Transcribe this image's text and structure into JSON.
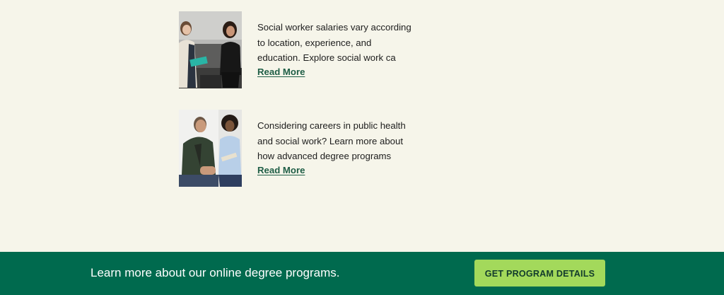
{
  "articles": [
    {
      "excerpt": "Social worker salaries vary according to location, experience, and education. Explore social work ca",
      "read_more_label": "Read More",
      "image_icon": "photo-two-women-sofa"
    },
    {
      "excerpt": "Considering careers in public health and social work? Learn more about how advanced degree programs",
      "read_more_label": "Read More",
      "image_icon": "photo-man-woman-counseling"
    }
  ],
  "cta": {
    "text": "Learn more about our online degree programs.",
    "button_label": "GET PROGRAM DETAILS"
  },
  "colors": {
    "page_background": "#f6f5ea",
    "link": "#1f5e46",
    "cta_bar": "#006a4e",
    "cta_button": "#a3d95b",
    "cta_button_text": "#123b2c"
  }
}
